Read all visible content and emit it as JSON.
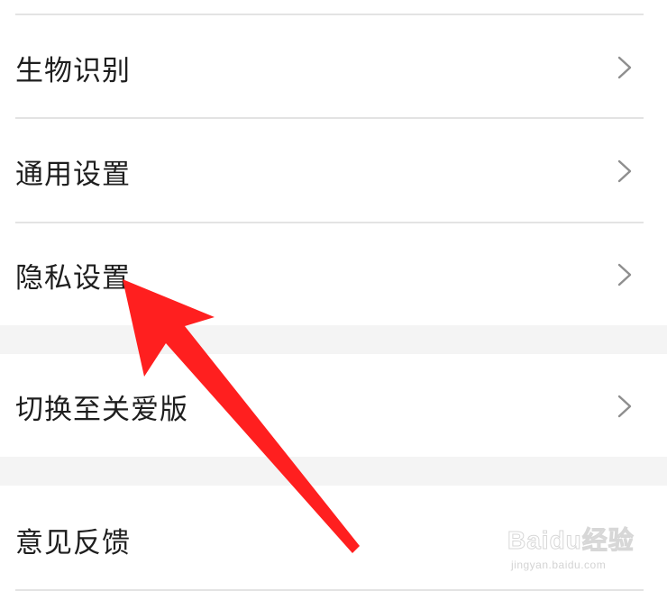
{
  "settings_list": {
    "groups": [
      {
        "items": [
          {
            "label": "生物识别",
            "icon": "chevron-right-icon"
          },
          {
            "label": "通用设置",
            "icon": "chevron-right-icon"
          },
          {
            "label": "隐私设置",
            "icon": "chevron-right-icon"
          }
        ]
      },
      {
        "items": [
          {
            "label": "切换至关爱版",
            "icon": "chevron-right-icon"
          }
        ]
      },
      {
        "items": [
          {
            "label": "意见反馈"
          }
        ]
      }
    ]
  },
  "annotation": {
    "type": "arrow",
    "color": "#ff1f1f",
    "points_to": "隐私设置"
  },
  "watermark": {
    "brand": "Baidu经验",
    "url": "jingyan.baidu.com"
  }
}
